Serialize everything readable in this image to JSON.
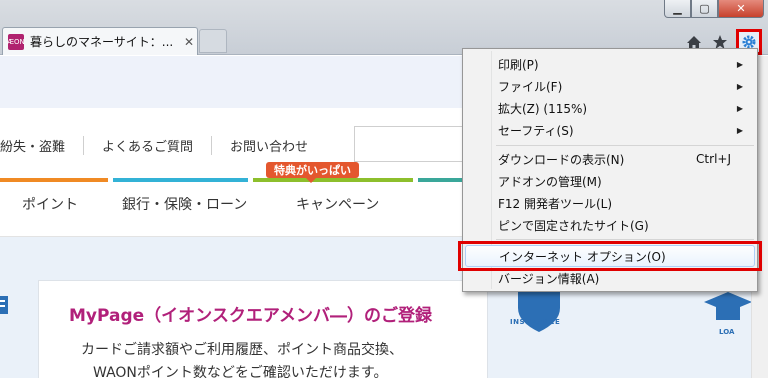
{
  "browser": {
    "tab": {
      "title": "暮らしのマネーサイト：...",
      "close_glyph": "✕",
      "favicon_text": "ÆON"
    },
    "window_buttons": {
      "minimize": "▁",
      "maximize": "▢",
      "close": "✕"
    },
    "toolbar": {
      "home_icon": "home-icon",
      "favorites_icon": "star-icon",
      "tools_icon": "gear-icon"
    }
  },
  "page": {
    "util_nav": [
      "紛失・盗難",
      "よくあるご質問",
      "お問い合わせ"
    ],
    "promo_badge": "特典がいっぱい",
    "main_nav": [
      "ポイント",
      "銀行・保険・ローン",
      "キャンペーン"
    ],
    "category_colors": [
      "#f08a24",
      "#33b2d6",
      "#8dbf2c",
      "#3aa79a"
    ],
    "card": {
      "title": "MyPage（イオンスクエアメンバ―）のご登録",
      "line1": "カードご請求額やご利用履歴、ポイント商品交換、",
      "line2": "WAONポイント数などをご確認いただけます。"
    },
    "icons": {
      "insurance_label": "INSURANCE",
      "loan_label": "LOA"
    }
  },
  "tools_menu": {
    "items": [
      {
        "label": "印刷(P)",
        "submenu": true
      },
      {
        "label": "ファイル(F)",
        "submenu": true
      },
      {
        "label": "拡大(Z) (115%)",
        "submenu": true
      },
      {
        "label": "セーフティ(S)",
        "submenu": true
      },
      {
        "label": "ダウンロードの表示(N)",
        "shortcut": "Ctrl+J"
      },
      {
        "label": "アドオンの管理(M)"
      },
      {
        "label": "F12 開発者ツール(L)"
      },
      {
        "label": "ピンで固定されたサイト(G)"
      },
      {
        "label": "インターネット オプション(O)",
        "highlighted": true
      },
      {
        "label": "バージョン情報(A)"
      }
    ],
    "submenu_arrow": "▶",
    "highlight_color": "#e00000"
  }
}
